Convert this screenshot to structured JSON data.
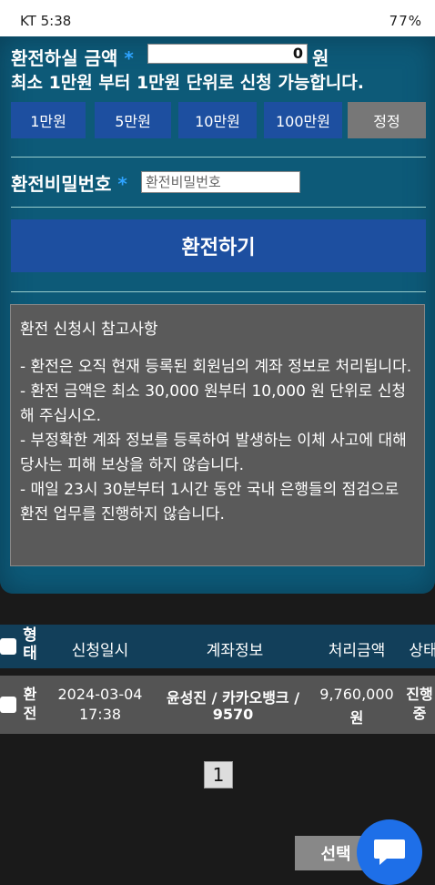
{
  "status_bar": {
    "left": "KT 5:38",
    "right": "77%"
  },
  "form": {
    "amount_label": "환전하실 금액",
    "required_mark": "*",
    "amount_value": "0",
    "won": "원",
    "note": "최소 1만원 부터 1만원 단위로 신청 가능합니다.",
    "quick_buttons": [
      "1만원",
      "5만원",
      "10만원",
      "100만원",
      "정정"
    ],
    "password_label": "환전비밀번호",
    "password_placeholder": "환전비밀번호",
    "submit_label": "환전하기"
  },
  "info": {
    "title": "환전 신청시 참고사항",
    "lines": [
      "- 환전은 오직 현재 등록된 회원님의 계좌 정보로 처리됩니다.",
      "- 환전 금액은 최소 30,000 원부터 10,000 원 단위로 신청해 주십시오.",
      "- 부정확한 계좌 정보를 등록하여 발생하는 이체 사고에 대해 당사는 피해 보상을 하지 않습니다.",
      "- 매일 23시 30분부터 1시간 동안 국내 은행들의 점검으로 환전 업무를 진행하지 않습니다."
    ]
  },
  "table": {
    "headers": {
      "type": "형태",
      "date": "신청일시",
      "account": "계좌정보",
      "amount": "처리금액",
      "status": "상태"
    },
    "rows": [
      {
        "type": "환전",
        "date": "2024-03-04",
        "time": "17:38",
        "account_line1": "윤성진 / 카카오뱅크 /",
        "account_line2": "9570",
        "amount": "9,760,000",
        "amount_unit": "원",
        "status": "진행중"
      }
    ]
  },
  "pagination": {
    "current": "1"
  },
  "actions": {
    "select_label": "선택"
  }
}
